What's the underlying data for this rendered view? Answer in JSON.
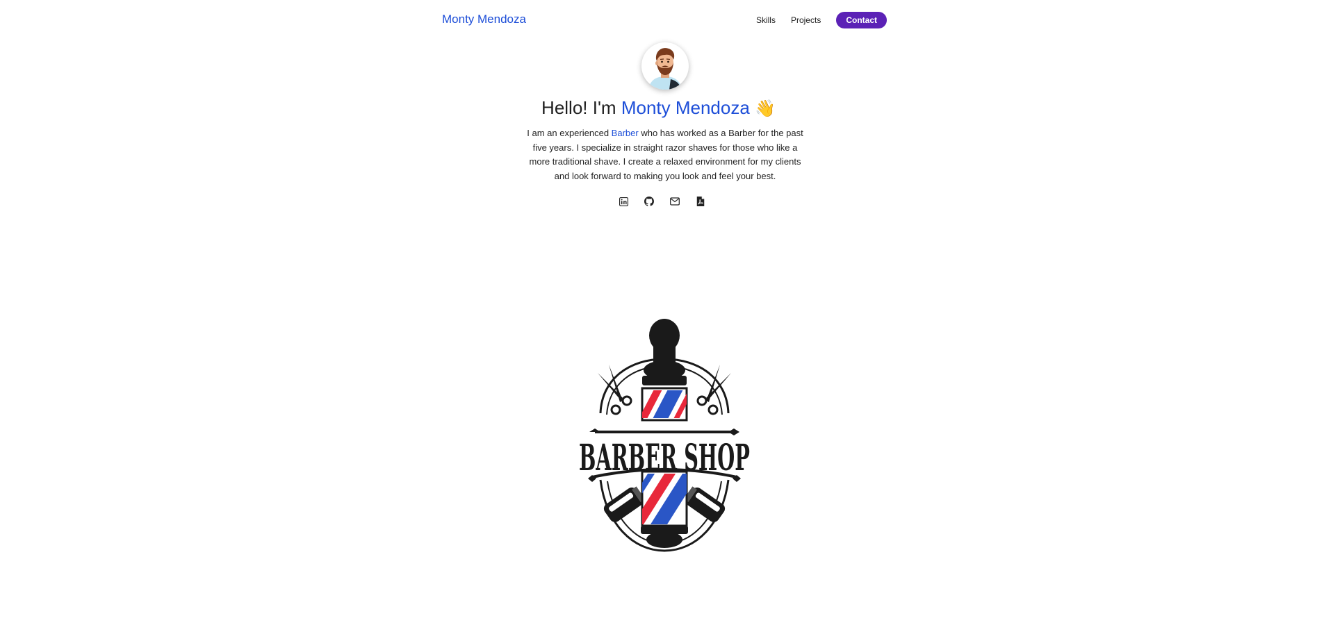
{
  "nav": {
    "brand": "Monty Mendoza",
    "links": [
      {
        "label": "Skills"
      },
      {
        "label": "Projects"
      }
    ],
    "contact_label": "Contact"
  },
  "hero": {
    "greeting": "Hello! I'm",
    "name": "Monty Mendoza",
    "wave_emoji": "👋",
    "intro_before": "I am an experienced",
    "intro_highlight": "Barber",
    "intro_after": "who has worked as a Barber for the past five years. I specialize in straight razor shaves for those who like a more traditional shave. I create a relaxed environment for my clients and look forward to making you look and feel your best."
  },
  "social": [
    {
      "icon": "linkedin-icon"
    },
    {
      "icon": "github-icon"
    },
    {
      "icon": "mail-icon"
    },
    {
      "icon": "pdf-resume-icon"
    }
  ],
  "logo": {
    "text": "BARBER SHOP"
  },
  "colors": {
    "accent": "#1d4ed8",
    "button": "#5b21b6",
    "pole_red": "#e8283a",
    "pole_blue": "#2a56c6"
  }
}
